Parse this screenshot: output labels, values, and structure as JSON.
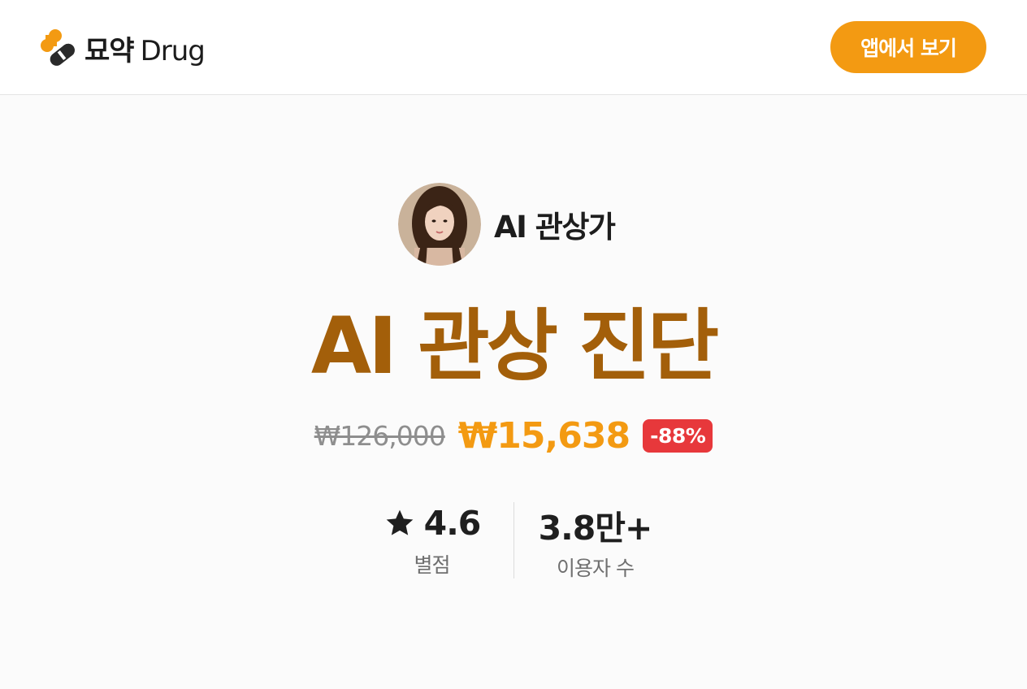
{
  "header": {
    "logo_text": "묘약",
    "logo_suffix": "Drug",
    "app_button_label": "앱에서 보기"
  },
  "profile": {
    "name": "AI 관상가"
  },
  "product": {
    "title": "AI 관상 진단",
    "original_price": "₩126,000",
    "sale_price": "₩15,638",
    "discount": "-88%"
  },
  "stats": {
    "rating": {
      "icon": "star-icon",
      "value": "4.6",
      "label": "별점"
    },
    "users": {
      "value": "3.8만+",
      "label": "이용자 수"
    }
  },
  "colors": {
    "accent": "#f39a12",
    "title": "#a35f0a",
    "discount_badge": "#e7383b",
    "strikethrough": "#8e8e8e"
  }
}
